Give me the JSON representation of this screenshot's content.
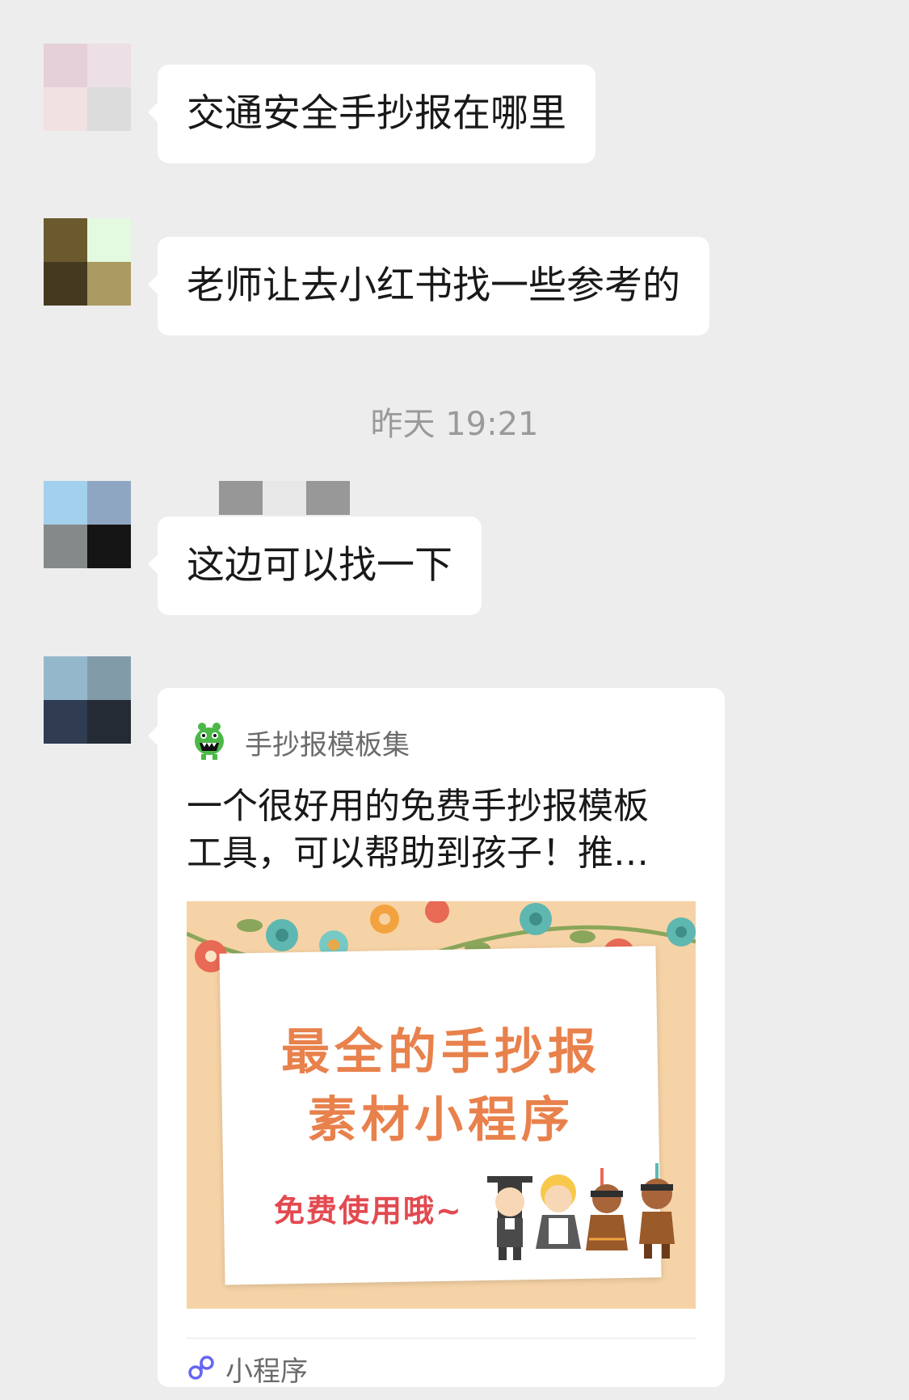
{
  "messages": [
    {
      "text": "交通安全手抄报在哪里"
    },
    {
      "text": "老师让去小红书找一些参考的"
    },
    {
      "text": "这边可以找一下"
    }
  ],
  "timestamp": "昨天 19:21",
  "card": {
    "app_name": "手抄报模板集",
    "title": "一个很好用的免费手抄报模板\n工具，可以帮助到孩子！推…",
    "poster": {
      "line1": "最全的手抄报",
      "line2": "素材小程序",
      "sub": "免费使用哦~"
    },
    "footer_label": "小程序",
    "app_icon": "green-monster-icon",
    "footer_icon": "mini-program-icon"
  },
  "colors": {
    "background": "#ededed",
    "bubble": "#ffffff",
    "poster_title": "#e8814c",
    "poster_sub": "#e24a50"
  }
}
